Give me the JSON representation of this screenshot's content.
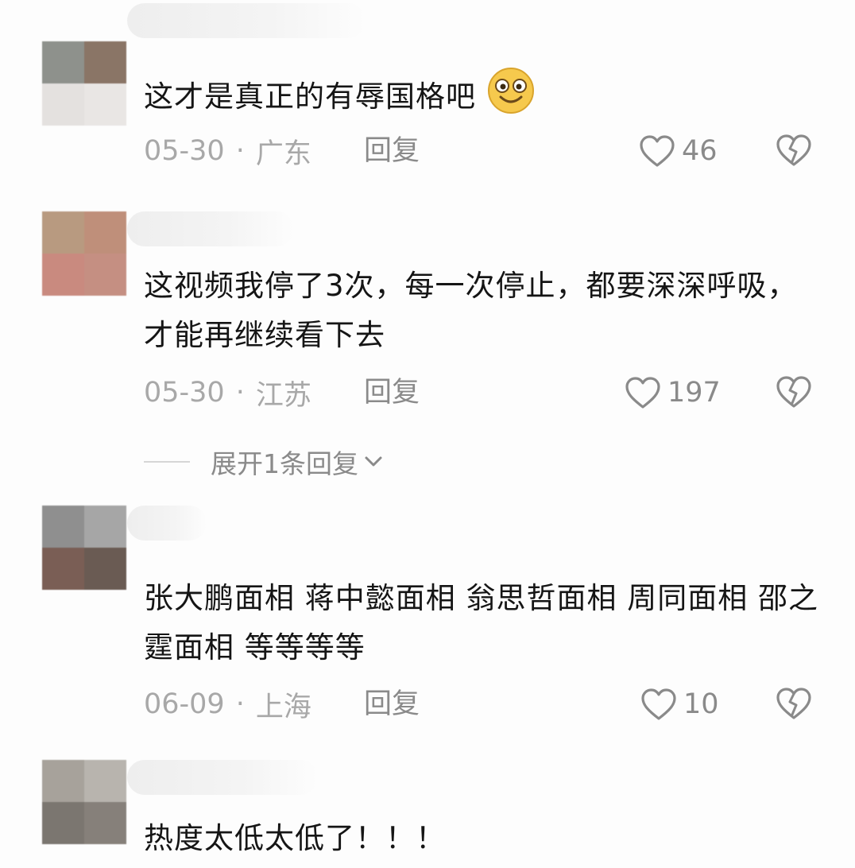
{
  "comments": [
    {
      "text": "这才是真正的有辱国格吧",
      "emoji": "smiling-face-emoji",
      "date": "05-30",
      "sep": "·",
      "location": "广东",
      "reply_label": "回复",
      "likes": "46"
    },
    {
      "text": "这视频我停了3次，每一次停止，都要深深呼吸，才能再继续看下去",
      "date": "05-30",
      "sep": "·",
      "location": "江苏",
      "reply_label": "回复",
      "likes": "197",
      "expand_label": "展开1条回复"
    },
    {
      "text": "张大鹏面相 蒋中懿面相 翁思哲面相 周同面相 邵之霆面相 等等等等",
      "date": "06-09",
      "sep": "·",
      "location": "上海",
      "reply_label": "回复",
      "likes": "10"
    },
    {
      "text": "热度太低太低了！！！"
    }
  ],
  "icons": {
    "like": "heart-outline-icon",
    "dislike": "broken-heart-icon",
    "expand": "chevron-down-icon"
  },
  "colors": {
    "text": "#151515",
    "meta": "#a8a8a8",
    "action": "#8a8a8a"
  }
}
